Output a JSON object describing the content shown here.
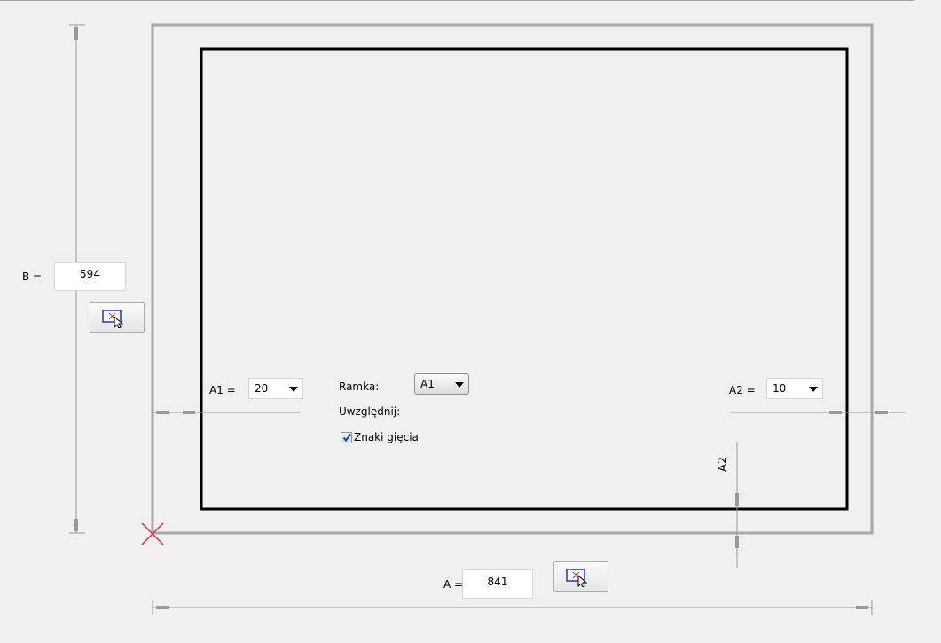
{
  "height_field": {
    "label": "B =",
    "value": "594"
  },
  "width_field": {
    "label": "A =",
    "value": "841"
  },
  "margin_left": {
    "label": "A1 =",
    "value": "20"
  },
  "margin_right": {
    "label": "A2 =",
    "value": "10"
  },
  "frame": {
    "label": "Ramka:",
    "value": "A1"
  },
  "include": {
    "label": "Uwzględnij:",
    "fold_marks_label": "Znaki gięcia",
    "fold_marks_checked": true
  },
  "dimension_marker": {
    "label": "A2"
  },
  "icons": {
    "pick_height": "select-area-cursor-icon",
    "pick_width": "select-area-cursor-icon",
    "origin_marker": "red-x-icon"
  },
  "colors": {
    "outer_sheet": "#a9a9a9",
    "inner_frame": "#000000",
    "origin_marker": "#e03030",
    "dimension_line": "#999999"
  }
}
